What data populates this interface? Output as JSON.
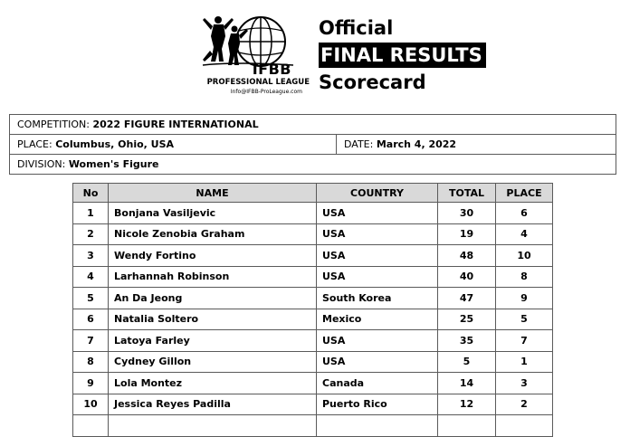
{
  "header": {
    "logo": {
      "brand": "IFBB",
      "league": "PROFESSIONAL LEAGUE",
      "email": "Info@IFBB-ProLeague.com"
    },
    "title_line1": "Official",
    "title_line2": "FINAL RESULTS",
    "title_line3": "Scorecard"
  },
  "info": {
    "competition_label": "COMPETITION:",
    "competition_value": "2022 FIGURE INTERNATIONAL",
    "place_label": "PLACE:",
    "place_value": "Columbus, Ohio, USA",
    "date_label": "DATE:",
    "date_value": "March 4, 2022",
    "division_label": "DIVISION:",
    "division_value": "Women's Figure"
  },
  "table": {
    "headers": [
      "No",
      "NAME",
      "COUNTRY",
      "TOTAL",
      "PLACE"
    ],
    "rows": [
      {
        "no": "1",
        "name": "Bonjana Vasiljevic",
        "country": "USA",
        "total": "30",
        "place": "6"
      },
      {
        "no": "2",
        "name": "Nicole Zenobia Graham",
        "country": "USA",
        "total": "19",
        "place": "4"
      },
      {
        "no": "3",
        "name": "Wendy Fortino",
        "country": "USA",
        "total": "48",
        "place": "10"
      },
      {
        "no": "4",
        "name": "Larhannah Robinson",
        "country": "USA",
        "total": "40",
        "place": "8"
      },
      {
        "no": "5",
        "name": "An Da Jeong",
        "country": "South Korea",
        "total": "47",
        "place": "9"
      },
      {
        "no": "6",
        "name": "Natalia Soltero",
        "country": "Mexico",
        "total": "25",
        "place": "5"
      },
      {
        "no": "7",
        "name": "Latoya Farley",
        "country": "USA",
        "total": "35",
        "place": "7"
      },
      {
        "no": "8",
        "name": "Cydney Gillon",
        "country": "USA",
        "total": "5",
        "place": "1"
      },
      {
        "no": "9",
        "name": "Lola Montez",
        "country": "Canada",
        "total": "14",
        "place": "3"
      },
      {
        "no": "10",
        "name": "Jessica Reyes Padilla",
        "country": "Puerto Rico",
        "total": "12",
        "place": "2"
      },
      {
        "no": "",
        "name": "",
        "country": "",
        "total": "",
        "place": ""
      }
    ]
  }
}
